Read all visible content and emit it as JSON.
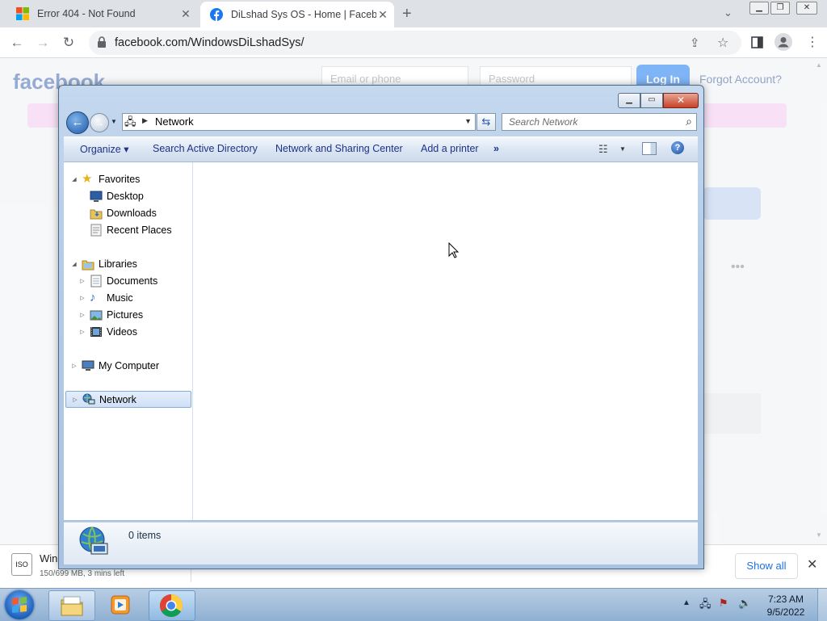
{
  "browser": {
    "tabs": [
      {
        "title": "Error 404 - Not Found",
        "icon": "windows-logo-icon",
        "active": false
      },
      {
        "title": "DiLshad Sys OS - Home | Facebo",
        "icon": "facebook-icon",
        "active": true
      }
    ],
    "url": "facebook.com/WindowsDiLshadSys/"
  },
  "facebook_page": {
    "logo": "facebook",
    "email_placeholder": "Email or phone",
    "password_placeholder": "Password",
    "login_label": "Log In",
    "forgot_label": "Forgot Account?"
  },
  "explorer": {
    "address": "Network",
    "search_placeholder": "Search Network",
    "commands": [
      "Organize",
      "Search Active Directory",
      "Network and Sharing Center",
      "Add a printer",
      "»"
    ],
    "nav": {
      "favorites": {
        "label": "Favorites",
        "items": [
          "Desktop",
          "Downloads",
          "Recent Places"
        ]
      },
      "libraries": {
        "label": "Libraries",
        "items": [
          "Documents",
          "Music",
          "Pictures",
          "Videos"
        ]
      },
      "computer": "My Computer",
      "network": "Network"
    },
    "status": "0 items"
  },
  "downloads": {
    "name": "Win",
    "status": "150/699 MB, 3 mins left",
    "show_all": "Show all"
  },
  "taskbar": {
    "time": "7:23 AM",
    "date": "9/5/2022"
  },
  "colors": {
    "facebook_blue": "#1877f2",
    "selection": "#cfe0f6",
    "command_text": "#1e3287"
  }
}
